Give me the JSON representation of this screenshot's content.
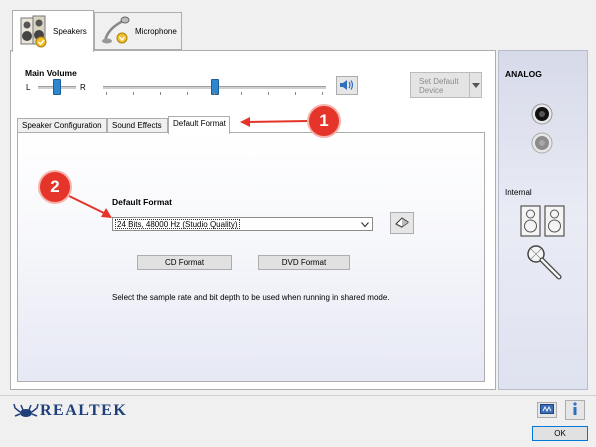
{
  "device_tabs": [
    {
      "label": "Speakers",
      "active": true
    },
    {
      "label": "Microphone",
      "active": false
    }
  ],
  "main_volume": {
    "title": "Main Volume",
    "left_label": "L",
    "right_label": "R",
    "balance": 0.5,
    "level": 0.5
  },
  "set_default": {
    "label": "Set Default Device",
    "enabled": false
  },
  "sub_tabs": [
    {
      "label": "Speaker Configuration",
      "active": false
    },
    {
      "label": "Sound Effects",
      "active": false
    },
    {
      "label": "Default Format",
      "active": true
    }
  ],
  "default_format": {
    "title": "Default Format",
    "selected": "24 Bits, 48000 Hz (Studio Quality)",
    "cd_button": "CD Format",
    "dvd_button": "DVD Format",
    "description": "Select the sample rate and bit depth to be used when running in shared mode."
  },
  "callouts": [
    "1",
    "2"
  ],
  "analog": {
    "title": "ANALOG",
    "internal_label": "Internal"
  },
  "footer": {
    "brand": "REALTEK",
    "ok_label": "OK"
  },
  "colors": {
    "accent": "#2e86d0",
    "callout": "#e5342a",
    "brand": "#1e3f7a"
  }
}
